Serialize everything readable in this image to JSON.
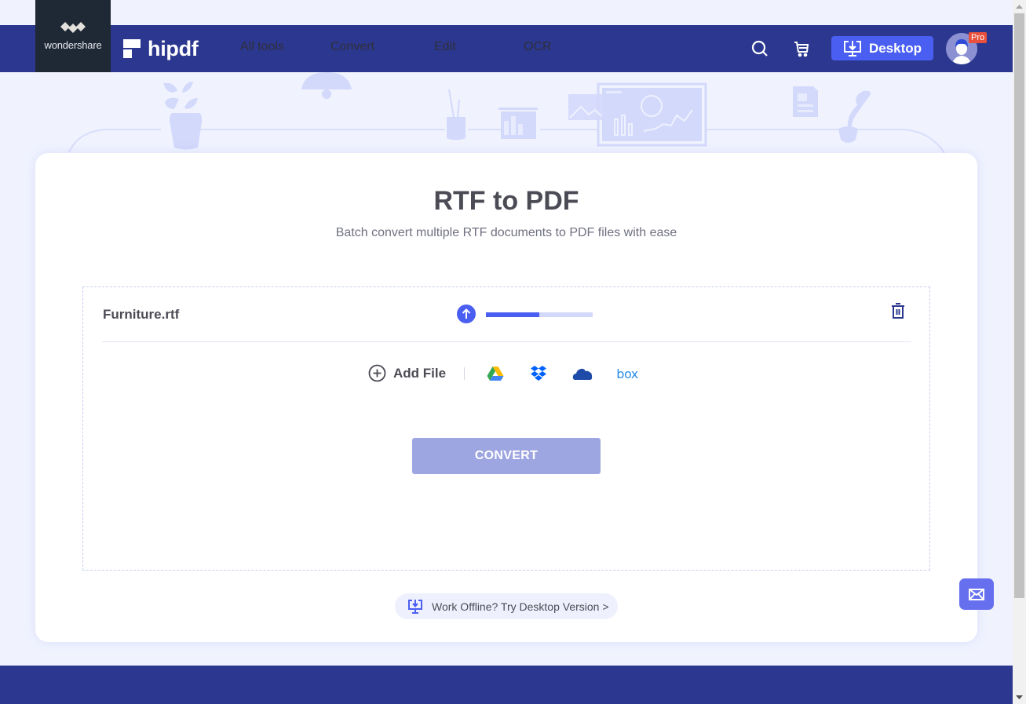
{
  "brand": {
    "parent": "wondershare",
    "product": "hipdf"
  },
  "nav": {
    "items": [
      {
        "label": "All tools"
      },
      {
        "label": "Convert"
      },
      {
        "label": "Edit"
      },
      {
        "label": "OCR"
      }
    ],
    "search_icon": "search-icon",
    "cart_icon": "cart-icon",
    "desktop_button": "Desktop",
    "avatar_badge": "Pro"
  },
  "page": {
    "title": "RTF to PDF",
    "subtitle": "Batch convert multiple RTF documents to PDF files with ease"
  },
  "upload": {
    "file_name": "Furniture.rtf",
    "progress_percent": 50,
    "add_file_label": "Add File",
    "cloud_sources": [
      "Google Drive",
      "Dropbox",
      "OneDrive",
      "box"
    ],
    "box_label": "box",
    "convert_label": "CONVERT"
  },
  "offline_banner": "Work Offline? Try Desktop Version >",
  "colors": {
    "header_bg": "#2c3890",
    "accent": "#4a5ff1",
    "convert_disabled": "#9ea6e2",
    "pro_badge": "#e9503d"
  }
}
